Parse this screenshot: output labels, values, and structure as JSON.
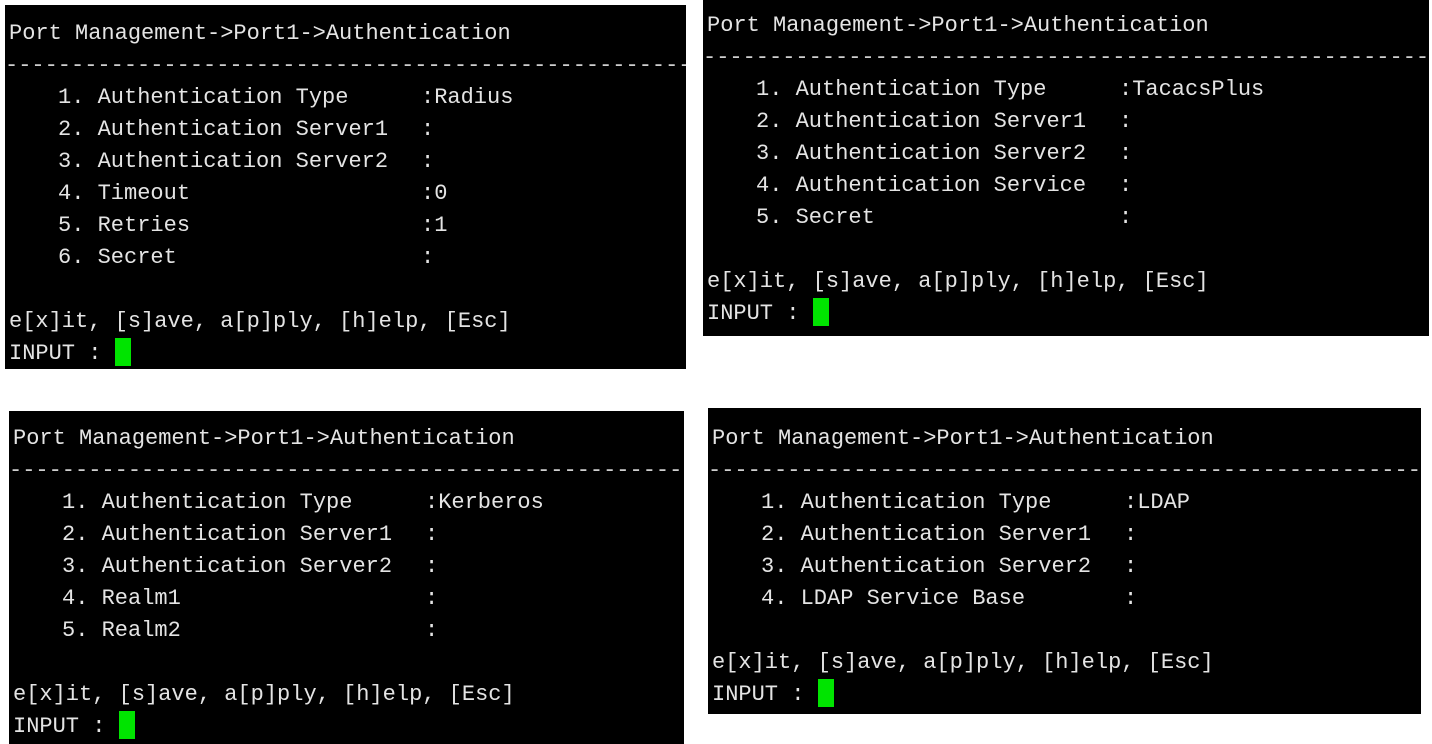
{
  "divider_text": "--------------------------------------------------------",
  "terminals": [
    {
      "breadcrumb": "Port Management->Port1->Authentication",
      "items": [
        {
          "label": "1. Authentication Type",
          "value": ":Radius"
        },
        {
          "label": "2. Authentication Server1",
          "value": ":"
        },
        {
          "label": "3. Authentication Server2",
          "value": ":"
        },
        {
          "label": "4. Timeout",
          "value": ":0"
        },
        {
          "label": "5. Retries",
          "value": ":1"
        },
        {
          "label": "6. Secret",
          "value": ":"
        }
      ],
      "commands": "e[x]it, [s]ave, a[p]ply, [h]elp, [Esc]",
      "input_prompt": "INPUT : "
    },
    {
      "breadcrumb": "Port Management->Port1->Authentication",
      "items": [
        {
          "label": "1. Authentication Type",
          "value": ":TacacsPlus"
        },
        {
          "label": "2. Authentication Server1",
          "value": ":"
        },
        {
          "label": "3. Authentication Server2",
          "value": ":"
        },
        {
          "label": "4. Authentication Service",
          "value": ":"
        },
        {
          "label": "5. Secret",
          "value": ":"
        }
      ],
      "commands": "e[x]it, [s]ave, a[p]ply, [h]elp, [Esc]",
      "input_prompt": "INPUT : "
    },
    {
      "breadcrumb": "Port Management->Port1->Authentication",
      "items": [
        {
          "label": "1. Authentication Type",
          "value": ":Kerberos"
        },
        {
          "label": "2. Authentication Server1",
          "value": ":"
        },
        {
          "label": "3. Authentication Server2",
          "value": ":"
        },
        {
          "label": "4. Realm1",
          "value": ":"
        },
        {
          "label": "5. Realm2",
          "value": ":"
        }
      ],
      "commands": "e[x]it, [s]ave, a[p]ply, [h]elp, [Esc]",
      "input_prompt": "INPUT : "
    },
    {
      "breadcrumb": "Port Management->Port1->Authentication",
      "items": [
        {
          "label": "1. Authentication Type",
          "value": ":LDAP"
        },
        {
          "label": "2. Authentication Server1",
          "value": ":"
        },
        {
          "label": "3. Authentication Server2",
          "value": ":"
        },
        {
          "label": "4. LDAP Service Base",
          "value": ":"
        }
      ],
      "commands": "e[x]it, [s]ave, a[p]ply, [h]elp, [Esc]",
      "input_prompt": "INPUT : "
    }
  ],
  "colors": {
    "background": "#000000",
    "text": "#e4e4e4",
    "cursor": "#00e400"
  }
}
